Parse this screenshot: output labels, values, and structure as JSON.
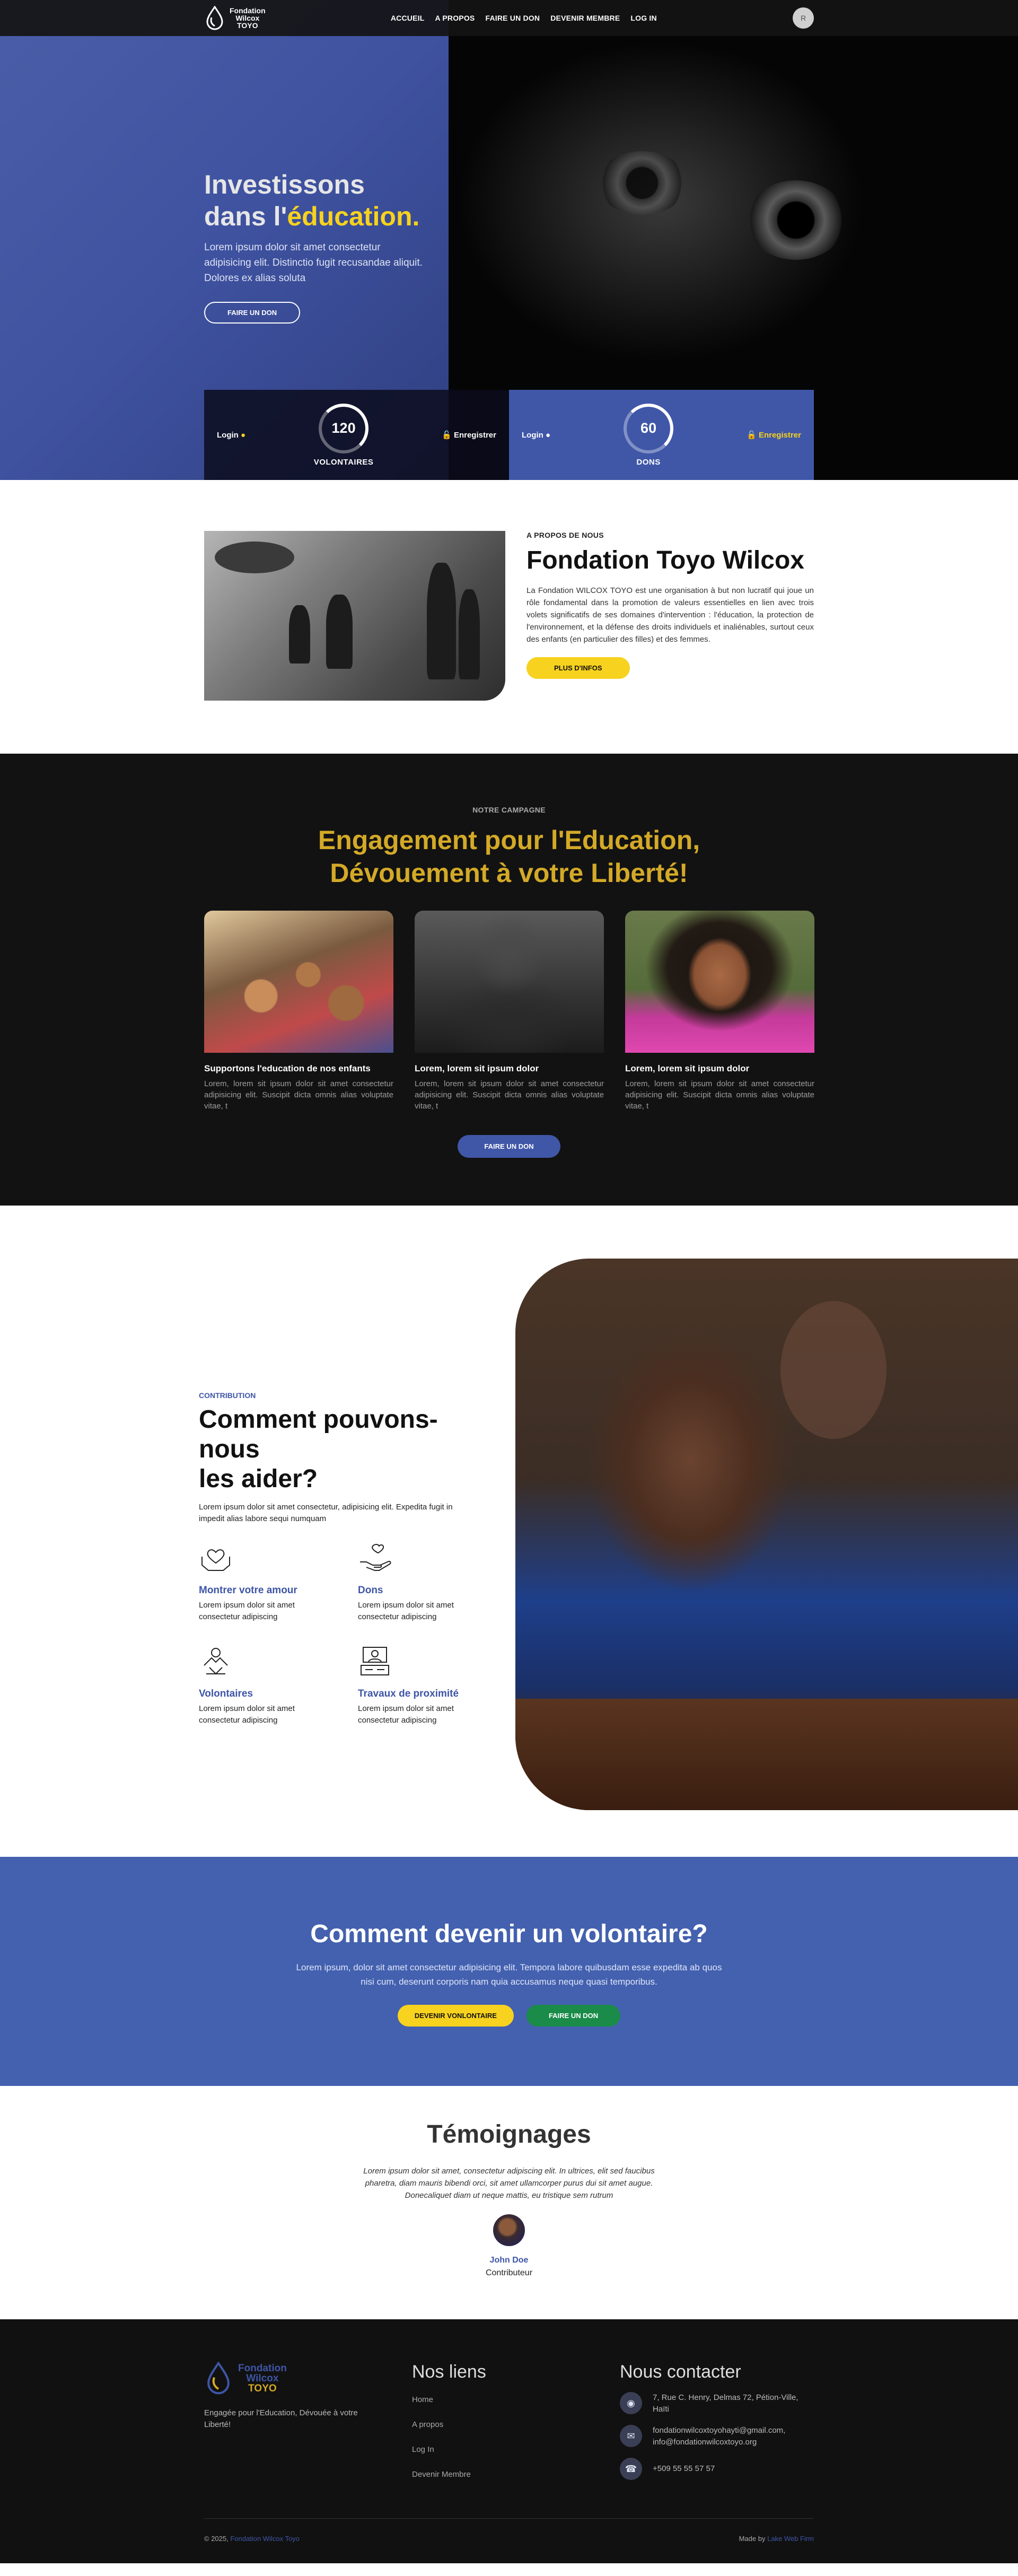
{
  "nav": {
    "logo_line1": "Fondation",
    "logo_line2": "Wilcox",
    "logo_line3": "TOYO",
    "items": [
      "ACCUEIL",
      "A PROPOS",
      "FAIRE UN DON",
      "DEVENIR MEMBRE",
      "LOG IN"
    ],
    "avatar_initial": "R"
  },
  "hero": {
    "title_line1": "Investissons",
    "title_line2_prefix": "dans l'",
    "title_highlight": "éducation.",
    "text": "Lorem ipsum dolor sit amet consectetur adipisicing elit. Distinctio fugit recusandae aliquit. Dolores ex alias soluta",
    "cta": "FAIRE UN DON"
  },
  "stats": [
    {
      "login": "Login",
      "value": "120",
      "label": "VOLONTAIRES",
      "register": "Enregistrer"
    },
    {
      "login": "Login",
      "value": "60",
      "label": "DONS",
      "register": "Enregistrer"
    }
  ],
  "about": {
    "eyebrow": "A PROPOS DE NOUS",
    "title": "Fondation Toyo Wilcox",
    "text": "La Fondation WILCOX TOYO est une organisation à but non lucratif qui joue un rôle fondamental dans la promotion de valeurs essentielles en lien avec trois volets significatifs de ses domaines d'intervention : l'éducation, la protection de l'environnement, et la défense des droits individuels et inaliénables, surtout ceux des enfants (en particulier des filles) et des femmes.",
    "cta": "PLUS D'INFOS"
  },
  "campaign": {
    "eyebrow": "NOTRE CAMPAGNE",
    "title_line1": "Engagement pour l'Education,",
    "title_line2": "Dévouement à votre Liberté!",
    "cards": [
      {
        "title": "Supportons l'education de nos enfants",
        "text": "Lorem, lorem sit ipsum dolor sit amet consectetur adipisicing elit. Suscipit dicta omnis alias voluptate vitae, t"
      },
      {
        "title": "Lorem, lorem sit ipsum dolor",
        "text": "Lorem, lorem sit ipsum dolor sit amet consectetur adipisicing elit. Suscipit dicta omnis alias voluptate vitae, t"
      },
      {
        "title": "Lorem, lorem sit ipsum dolor",
        "text": "Lorem, lorem sit ipsum dolor sit amet consectetur adipisicing elit. Suscipit dicta omnis alias voluptate vitae, t"
      }
    ],
    "cta": "FAIRE UN DON"
  },
  "help": {
    "eyebrow": "CONTRIBUTION",
    "title_line1": "Comment pouvons-nous",
    "title_line2": "les aider?",
    "lead": "Lorem ipsum dolor sit amet consectetur, adipisicing elit. Expedita fugit in impedit alias labore sequi numquam",
    "features": [
      {
        "icon": "heart-hands-icon",
        "title": "Montrer votre amour",
        "text": "Lorem ipsum dolor sit amet consectetur adipiscing"
      },
      {
        "icon": "donation-hand-icon",
        "title": "Dons",
        "text": "Lorem ipsum dolor sit amet consectetur adipiscing"
      },
      {
        "icon": "volunteer-hands-icon",
        "title": "Volontaires",
        "text": "Lorem ipsum dolor sit amet consectetur adipiscing"
      },
      {
        "icon": "community-work-icon",
        "title": "Travaux de proximité",
        "text": "Lorem ipsum dolor sit amet consectetur adipiscing"
      }
    ]
  },
  "volunteer": {
    "title": "Comment devenir un volontaire?",
    "text": "Lorem ipsum, dolor sit amet consectetur adipisicing elit. Tempora labore quibusdam esse expedita ab quos nisi cum, deserunt corporis nam quia accusamus neque quasi temporibus.",
    "cta_primary": "DEVENIR VONLONTAIRE",
    "cta_secondary": "FAIRE UN DON"
  },
  "testimonials": {
    "title": "Témoignages",
    "quote": "Lorem ipsum dolor sit amet, consectetur adipiscing elit. In ultrices, elit sed faucibus pharetra, diam mauris bibendi orci, sit amet ullamcorper purus dui sit amet augue. Donecaliquet diam ut neque mattis, eu tristique sem rutrum",
    "name": "John Doe",
    "role": "Contributeur"
  },
  "footer": {
    "logo_line1": "Fondation",
    "logo_line2": "Wilcox",
    "logo_line3": "TOYO",
    "tagline": "Engagée pour l'Education, Dévouée à votre Liberté!",
    "links_title": "Nos liens",
    "links": [
      "Home",
      "A propos",
      "Log In",
      "Devenir Membre"
    ],
    "contact_title": "Nous contacter",
    "address": "7, Rue C. Henry, Delmas 72, Pétion-Ville, Haïti",
    "email1": "fondationwilcoxtoyohayti@gmail.com,",
    "email2": "info@fondationwilcoxtoyo.org",
    "phone": "+509 55 55 57 57",
    "copyright_prefix": "© 2025,",
    "copyright_link": "Fondation Wilcox Toyo",
    "made_by_prefix": "Made by",
    "made_by_link": "Lake Web Firm"
  },
  "colors": {
    "brand_blue": "#4057a8",
    "brand_yellow": "#f7d21e",
    "gold": "#d3a927",
    "green": "#1a8b49",
    "dark": "#121212"
  }
}
